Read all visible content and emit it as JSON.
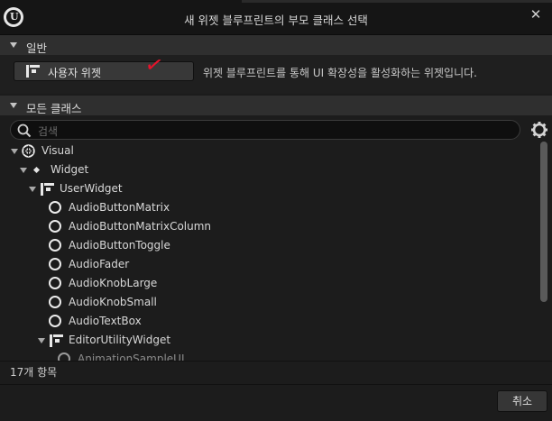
{
  "window": {
    "title": "새 위젯 블루프린트의 부모 클래스 선택",
    "close_glyph": "✕",
    "logo_icon": "unreal-logo-icon"
  },
  "general": {
    "header": "일반",
    "user_widget_button": "사용자 위젯",
    "description": "위젯 블루프린트를 통해 UI 확장성을 활성화하는 위젯입니다.",
    "checkmark": "✓",
    "checkmark_color": "#e8132b"
  },
  "all_classes": {
    "header": "모든 클래스",
    "search_placeholder": "검색",
    "settings_icon": "gear-icon"
  },
  "tree": {
    "visual": "Visual",
    "widget": "Widget",
    "user_widget": "UserWidget",
    "items": [
      "AudioButtonMatrix",
      "AudioButtonMatrixColumn",
      "AudioButtonToggle",
      "AudioFader",
      "AudioKnobLarge",
      "AudioKnobSmall",
      "AudioTextBox"
    ],
    "editor_utility_widget": "EditorUtilityWidget",
    "partial_item": "AnimationSampleUI"
  },
  "footer": {
    "item_count": "17개 항목",
    "cancel": "취소"
  }
}
